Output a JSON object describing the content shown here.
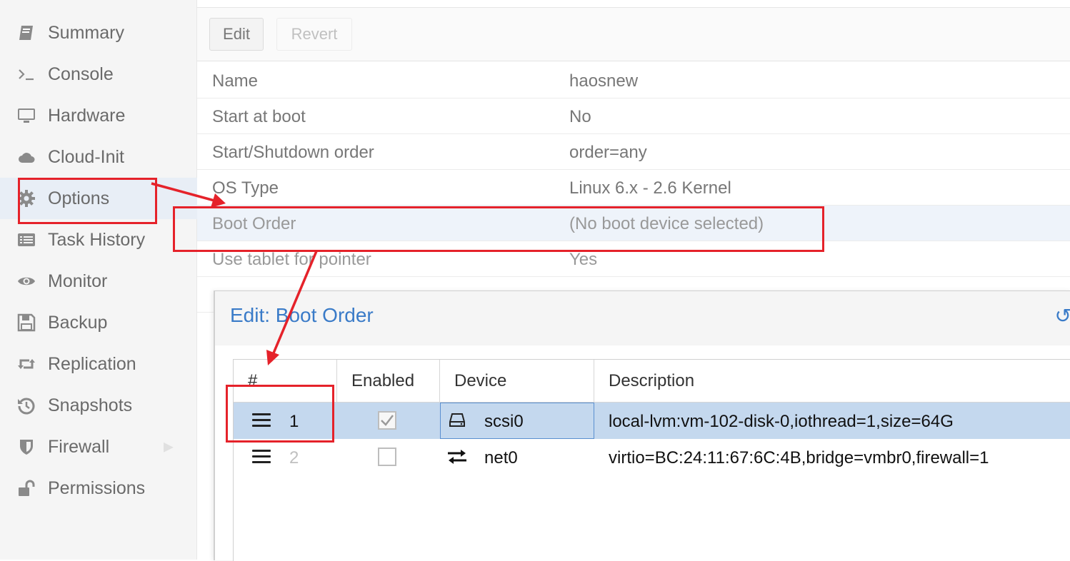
{
  "sidebar": {
    "items": [
      {
        "label": "Summary",
        "icon": "book-icon"
      },
      {
        "label": "Console",
        "icon": "terminal-icon"
      },
      {
        "label": "Hardware",
        "icon": "desktop-icon"
      },
      {
        "label": "Cloud-Init",
        "icon": "cloud-icon"
      },
      {
        "label": "Options",
        "icon": "gear-icon",
        "selected": true
      },
      {
        "label": "Task History",
        "icon": "list-icon"
      },
      {
        "label": "Monitor",
        "icon": "eye-icon"
      },
      {
        "label": "Backup",
        "icon": "floppy-icon"
      },
      {
        "label": "Replication",
        "icon": "retweet-icon"
      },
      {
        "label": "Snapshots",
        "icon": "history-icon"
      },
      {
        "label": "Firewall",
        "icon": "shield-icon"
      },
      {
        "label": "Permissions",
        "icon": "unlock-icon"
      }
    ]
  },
  "toolbar": {
    "edit_label": "Edit",
    "revert_label": "Revert"
  },
  "options": {
    "rows": [
      {
        "key": "Name",
        "value": "haosnew"
      },
      {
        "key": "Start at boot",
        "value": "No"
      },
      {
        "key": "Start/Shutdown order",
        "value": "order=any"
      },
      {
        "key": "OS Type",
        "value": "Linux 6.x - 2.6 Kernel"
      },
      {
        "key": "Boot Order",
        "value": "(No boot device selected)",
        "selected": true
      },
      {
        "key": "Use tablet for pointer",
        "value": "Yes"
      }
    ]
  },
  "modal": {
    "title": "Edit: Boot Order",
    "columns": {
      "num": "#",
      "enabled": "Enabled",
      "device": "Device",
      "description": "Description"
    },
    "rows": [
      {
        "num": "1",
        "enabled": true,
        "device": "scsi0",
        "device_icon": "hdd-icon",
        "description": "local-lvm:vm-102-disk-0,iothread=1,size=64G",
        "selected": true
      },
      {
        "num": "2",
        "enabled": false,
        "device": "net0",
        "device_icon": "exchange-icon",
        "description": "virtio=BC:24:11:67:6C:4B,bridge=vmbr0,firewall=1",
        "selected": false
      }
    ]
  },
  "colors": {
    "accent": "#3a7bc8",
    "annotation": "#e5222a",
    "selected_row": "#c4d8ee"
  }
}
